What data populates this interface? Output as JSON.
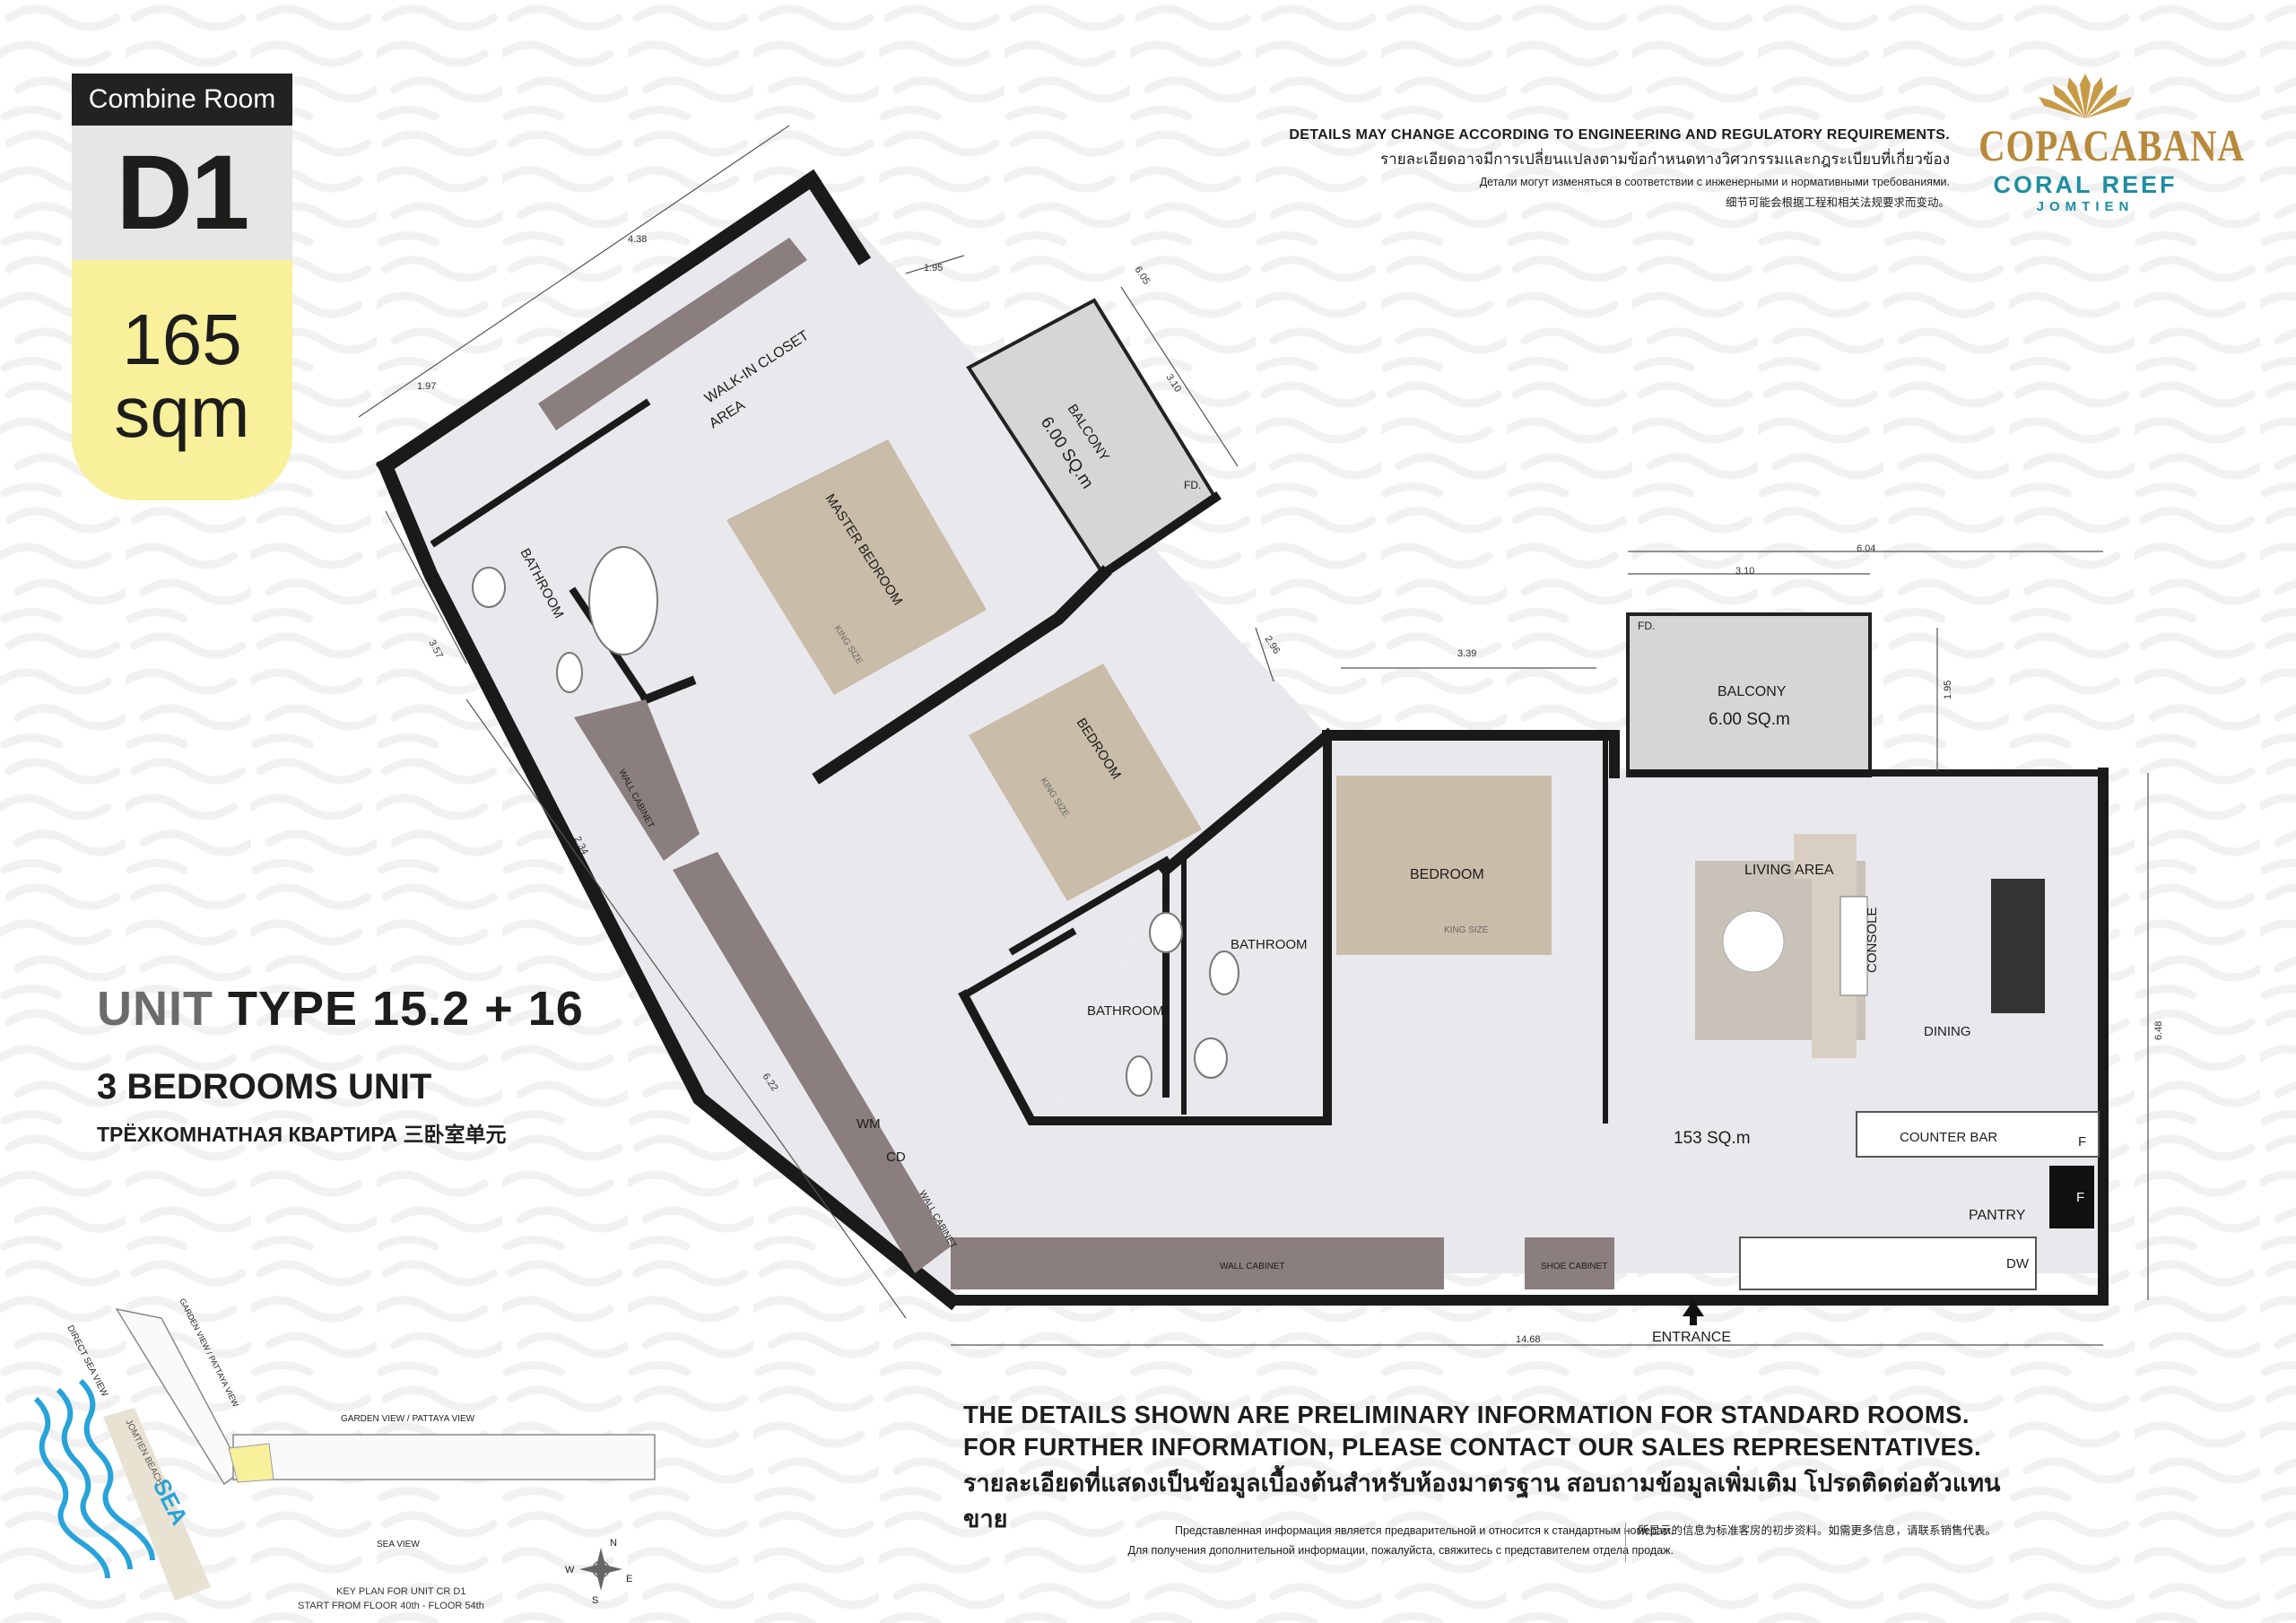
{
  "badge": {
    "title": "Combine Room",
    "code": "D1",
    "area_value": "165",
    "area_unit": "sqm"
  },
  "disclaimer": {
    "en": "DETAILS MAY CHANGE ACCORDING TO ENGINEERING AND REGULATORY REQUIREMENTS.",
    "th": "รายละเอียดอาจมีการเปลี่ยนแปลงตามข้อกำหนดทางวิศวกรรมและกฎระเบียบที่เกี่ยวข้อง",
    "ru": "Детали могут изменяться в соответствии с инженерными и нормативными требованиями.",
    "zh": "细节可能会根据工程和相关法规要求而变动。"
  },
  "logo": {
    "name": "COPACABANA",
    "line2": "CORAL REEF",
    "line3": "JOMTIEN"
  },
  "unit": {
    "type_prefix": "UNIT",
    "type_value": "TYPE 15.2 + 16",
    "bedrooms": "3 BEDROOMS UNIT",
    "bedrooms_ru_zh": "ТРЁХКОМНАТНАЯ КВАРТИРА  三卧室单元"
  },
  "rooms": {
    "walk_in_1": "WALK-IN CLOSET",
    "walk_in_2": "AREA",
    "master": "MASTER BEDROOM",
    "king1": "KING SIZE",
    "bathroom_a": "BATHROOM",
    "balcony_a_1": "BALCONY",
    "balcony_a_2": "6.00 SQ.m",
    "fd_a": "FD.",
    "bedroom_b": "BEDROOM",
    "king2": "KING SIZE",
    "wall_cabinet_a": "WALL CABINET",
    "bathroom_b": "BATHROOM",
    "bathroom_c": "BATHROOM",
    "bedroom_c": "BEDROOM",
    "king3": "KING SIZE",
    "fd_b": "FD.",
    "balcony_b_1": "BALCONY",
    "balcony_b_2": "6.00 SQ.m",
    "living": "LIVING AREA",
    "console": "CONSOLE",
    "dining": "DINING",
    "living_area": "153 SQ.m",
    "counter": "COUNTER BAR",
    "f1": "F",
    "f2": "F",
    "pantry": "PANTRY",
    "dw": "DW",
    "wm": "WM",
    "cd": "CD",
    "wall_cabinet_b": "WALL CABINET",
    "wall_cabinet_c": "WALL CABINET",
    "shoe_cabinet": "SHOE CABINET",
    "entrance": "ENTRANCE"
  },
  "dimensions": {
    "d1": "4.38",
    "d2": "1.97",
    "d3": "1.95",
    "d4": "6.05",
    "d5": "3.10",
    "d6": "3.57",
    "d7": "2.96",
    "d8": "2.34",
    "d9": "6.22",
    "d10": "3.39",
    "d11": "3.10",
    "d12": "6.04",
    "d13": "1.95",
    "d14": "6.48",
    "d15": "14.68"
  },
  "keyplan": {
    "garden_view_1": "GARDEN VIEW / PATTAYA VIEW",
    "garden_view_2": "GARDEN VIEW / PATTAYA VIEW",
    "direct_sea_view": "DIRECT SEA VIEW",
    "jomtien_beach": "JOMTIEN BEACH",
    "sea": "SEA",
    "sea_view": "SEA VIEW",
    "caption_1": "KEY PLAN FOR UNIT CR D1",
    "caption_2": "START FROM FLOOR 40th - FLOOR 54th",
    "compass_n": "N",
    "compass_w": "W",
    "compass_e": "E",
    "compass_s": "S"
  },
  "notes": {
    "en1": "THE DETAILS SHOWN ARE PRELIMINARY INFORMATION FOR STANDARD ROOMS.",
    "en2": "FOR FURTHER INFORMATION, PLEASE CONTACT OUR SALES REPRESENTATIVES.",
    "th": "รายละเอียดที่แสดงเป็นข้อมูลเบื้องต้นสำหรับห้องมาตรฐาน สอบถามข้อมูลเพิ่มเติม โปรดติดต่อตัวแทนขาย",
    "ru1": "Представленная информация является предварительной и относится к стандартным номерам.",
    "ru2": "Для получения дополнительной информации, пожалуйста, свяжитесь с представителем отдела продаж.",
    "zh": "所显示的信息为标准客房的初步资料。如需更多信息，请联系销售代表。"
  },
  "colors": {
    "wall": "#1a1a1a",
    "floor": "#e9e9ed",
    "bed": "#c9bca9",
    "cabinet": "#8a7e7e",
    "badge_yellow": "#f8f09a",
    "logo_gold": "#b8893a",
    "logo_teal": "#1e8ea0",
    "sea_blue": "#28a3d9"
  }
}
